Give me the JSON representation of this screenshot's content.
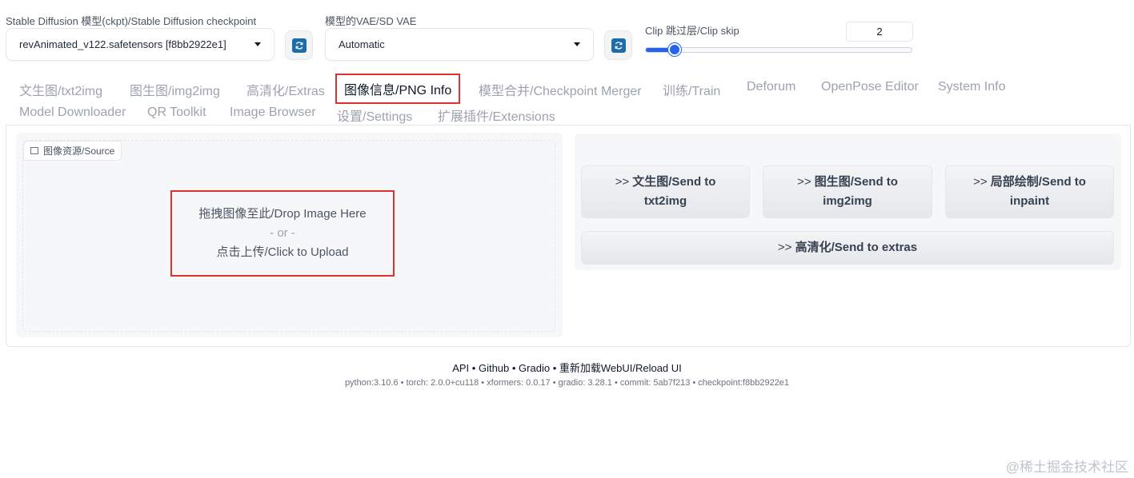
{
  "checkpoint": {
    "label": "Stable Diffusion 模型(ckpt)/Stable Diffusion checkpoint",
    "value": "revAnimated_v122.safetensors [f8bb2922e1]"
  },
  "vae": {
    "label": "模型的VAE/SD VAE",
    "value": "Automatic"
  },
  "clip_skip": {
    "label": "Clip 跳过层/Clip skip",
    "value": "2",
    "level_fraction": 0.11
  },
  "tabs": [
    {
      "label": "文生图/txt2img"
    },
    {
      "label": "图生图/img2img"
    },
    {
      "label": "高清化/Extras"
    },
    {
      "label": "图像信息/PNG Info"
    },
    {
      "label": "模型合并/Checkpoint Merger"
    },
    {
      "label": "训练/Train"
    },
    {
      "label": "Deforum"
    },
    {
      "label": "OpenPose Editor"
    },
    {
      "label": "System Info"
    },
    {
      "label": "Model Downloader"
    },
    {
      "label": "QR Toolkit"
    },
    {
      "label": "Image Browser"
    },
    {
      "label": "设置/Settings"
    },
    {
      "label": "扩展插件/Extensions"
    }
  ],
  "source": {
    "label": "图像资源/Source",
    "drop_text": "拖拽图像至此/Drop Image Here",
    "or_text": "- or -",
    "upload_text": "点击上传/Click to Upload"
  },
  "send_buttons": {
    "txt2img_bold": "文生图",
    "txt2img_prefix": ">> ",
    "txt2img_rest": "/Send to",
    "txt2img_line2": "txt2img",
    "img2img_prefix": ">> ",
    "img2img_bold": "图生图",
    "img2img_rest": "/Send to",
    "img2img_line2": "img2img",
    "inpaint_prefix": ">> ",
    "inpaint_bold": "局部绘制",
    "inpaint_rest": "/Send to",
    "inpaint_line2": "inpaint",
    "extras_prefix": ">> ",
    "extras_bold": "高清化",
    "extras_rest": "/Send to extras"
  },
  "footer": {
    "api": "API",
    "github": "Github",
    "gradio": "Gradio",
    "reload": "重新加载WebUI/Reload UI",
    "sep": " • ",
    "python": "python:3.10.6",
    "torch": "torch: 2.0.0+cu118",
    "xformers": "xformers: 0.0.17",
    "gradio_ver": "gradio: 3.28.1",
    "commit": "commit: 5ab7f213",
    "checkpoint": "checkpoint:f8bb2922e1"
  },
  "watermark": "@稀土掘金技术社区",
  "colors": {
    "accent": "#2563eb",
    "highlight": "#e03131",
    "refresh_icon": "#1d6ea8"
  }
}
